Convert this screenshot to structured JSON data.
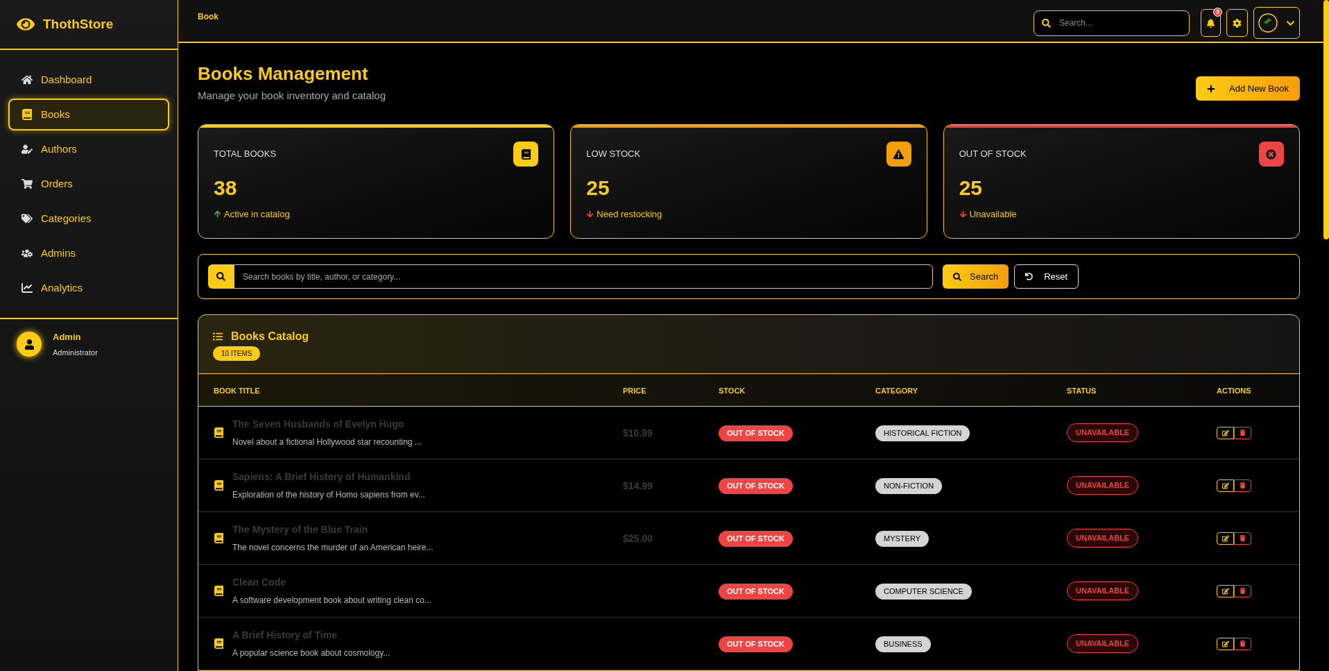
{
  "brand": "ThothStore",
  "sidebar": {
    "items": [
      {
        "label": "Dashboard",
        "selected": false
      },
      {
        "label": "Books",
        "selected": true
      },
      {
        "label": "Authors",
        "selected": false
      },
      {
        "label": "Orders",
        "selected": false
      },
      {
        "label": "Categories",
        "selected": false
      },
      {
        "label": "Admins",
        "selected": false
      },
      {
        "label": "Analytics",
        "selected": false
      }
    ],
    "user": {
      "name": "Admin",
      "role": "Administrator"
    }
  },
  "header": {
    "breadcrumb": "Book",
    "search_placeholder": "Search...",
    "notification_count": "3"
  },
  "page": {
    "title": "Books Management",
    "subtitle": "Manage your book inventory and catalog",
    "add_button": "Add New Book"
  },
  "stats": [
    {
      "kind": "total",
      "label": "TOTAL BOOKS",
      "value": "38",
      "note": "Active in catalog",
      "color": "#facc15"
    },
    {
      "kind": "low",
      "label": "LOW STOCK",
      "value": "25",
      "note": "Need restocking",
      "color": "#f59e0b"
    },
    {
      "kind": "out",
      "label": "OUT OF STOCK",
      "value": "25",
      "note": "Unavailable",
      "color": "#ef4444"
    }
  ],
  "filter": {
    "placeholder": "Search books by title, author, or category...",
    "search_button": "Search",
    "reset_button": "Reset"
  },
  "catalog": {
    "title": "Books Catalog",
    "count": "10 ITEMS",
    "columns": [
      "BOOK TITLE",
      "PRICE",
      "STOCK",
      "CATEGORY",
      "STATUS",
      "ACTIONS"
    ],
    "rows": [
      {
        "title": "The Seven Husbands of Evelyn Hugo",
        "description": "Novel about a fictional Hollywood star recounting ...",
        "price": "$10.99",
        "stock": "OUT OF STOCK",
        "category": "HISTORICAL FICTION",
        "status": "UNAVAILABLE"
      },
      {
        "title": "Sapiens: A Brief History of Humankind",
        "description": "Exploration of the history of Homo sapiens from ev...",
        "price": "$14.99",
        "stock": "OUT OF STOCK",
        "category": "NON-FICTION",
        "status": "UNAVAILABLE"
      },
      {
        "title": "The Mystery of the Blue Train",
        "description": "The novel concerns the murder of an American heire...",
        "price": "$25.00",
        "stock": "OUT OF STOCK",
        "category": "MYSTERY",
        "status": "UNAVAILABLE"
      },
      {
        "title": "Clean Code",
        "description": "A software development book about writing clean co...",
        "stock": "OUT OF STOCK",
        "category": "COMPUTER SCIENCE",
        "status": "UNAVAILABLE"
      },
      {
        "title": "A Brief History of Time",
        "description": "A popular science book about cosmology...",
        "stock": "OUT OF STOCK",
        "category": "BUSINESS",
        "status": "UNAVAILABLE"
      }
    ]
  }
}
